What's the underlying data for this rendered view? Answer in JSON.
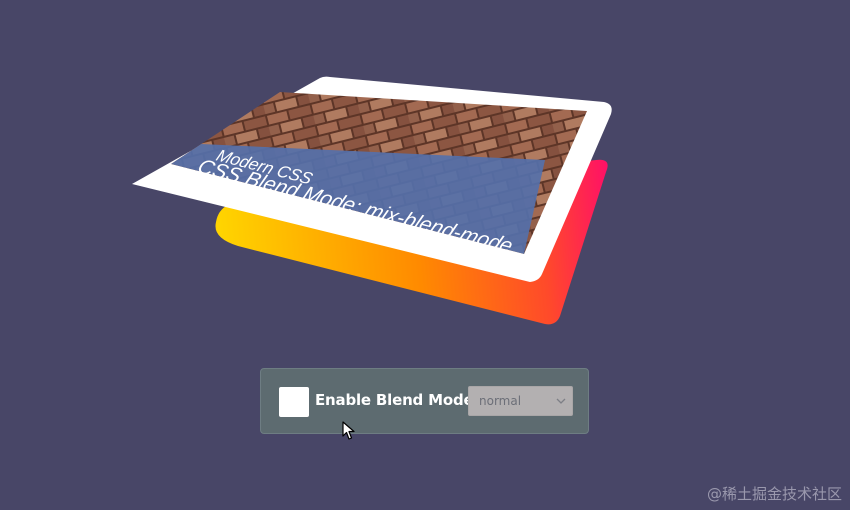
{
  "card": {
    "title_line1": "Modern CSS",
    "title_line2": "CSS Blend Mode: mix-blend-mode"
  },
  "controls": {
    "checkbox_label": "Enable Blend Mode",
    "checkbox_checked": false,
    "blend_mode_value": "normal"
  },
  "watermark": "@稀土掘金技术社区",
  "icons": {
    "dropdown": "chevron-down-icon",
    "pointer": "cursor-icon",
    "texture": "brick-wall-image"
  },
  "colors": {
    "background": "#484667",
    "panel": "#5d6b70",
    "gradient_start": "#ffd000",
    "gradient_mid": "#ff8a00",
    "gradient_end": "#ff1560",
    "text_band": "#5b73a8",
    "brick": "#8a5541"
  }
}
